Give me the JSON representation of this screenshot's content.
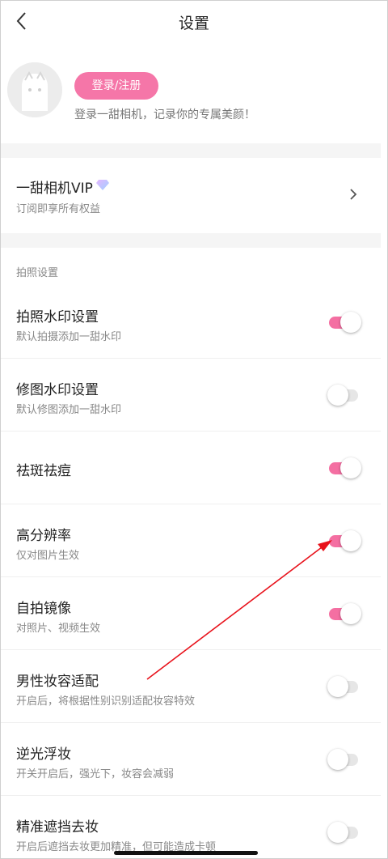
{
  "header": {
    "title": "设置"
  },
  "profile": {
    "login_label": "登录/注册",
    "tip": "登录一甜相机，记录你的专属美颜！"
  },
  "vip": {
    "title": "一甜相机VIP",
    "subtitle": "订阅即享所有权益"
  },
  "section": {
    "label": "拍照设置"
  },
  "settings": [
    {
      "title": "拍照水印设置",
      "subtitle": "默认拍摄添加一甜水印",
      "enabled": true
    },
    {
      "title": "修图水印设置",
      "subtitle": "默认修图添加一甜水印",
      "enabled": false
    },
    {
      "title": "祛斑祛痘",
      "subtitle": "",
      "enabled": true
    },
    {
      "title": "高分辨率",
      "subtitle": "仅对图片生效",
      "enabled": true
    },
    {
      "title": "自拍镜像",
      "subtitle": "对照片、视频生效",
      "enabled": true
    },
    {
      "title": "男性妆容适配",
      "subtitle": "开启后，将根据性别识别适配妆容特效",
      "enabled": false
    },
    {
      "title": "逆光浮妆",
      "subtitle": "开关开启后，强光下，妆容会减弱",
      "enabled": false
    },
    {
      "title": "精准遮挡去妆",
      "subtitle": "开启后遮挡去妆更加精准，但可能造成卡顿",
      "enabled": false
    }
  ],
  "colors": {
    "accent": "#f576a8",
    "annotation_arrow": "#e8121b"
  }
}
